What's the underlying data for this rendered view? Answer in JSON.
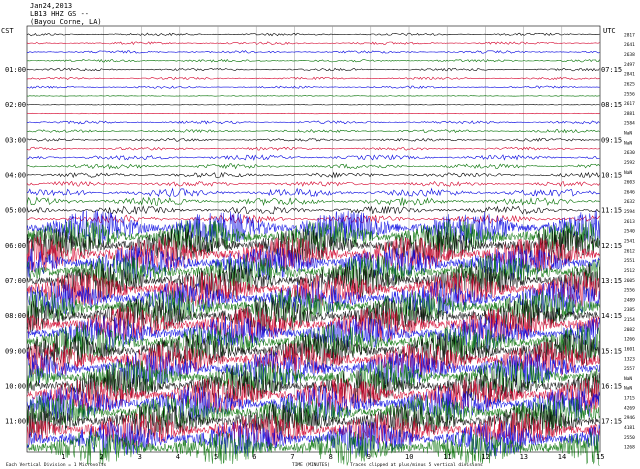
{
  "chart_data": {
    "type": "line",
    "title": "Jan24,2013",
    "subtitle": "LB13 HHZ GS --",
    "location": "(Bayou Corne, LA)",
    "left_timezone": "CST",
    "right_timezone": "UTC",
    "left_hour_labels": [
      "01:00",
      "02:00",
      "03:00",
      "04:00",
      "05:00",
      "06:00",
      "07:00",
      "08:00",
      "09:00",
      "10:00",
      "11:00"
    ],
    "right_hour_labels": [
      "07:15",
      "08:15",
      "09:15",
      "10:15",
      "11:15",
      "12:15",
      "13:15",
      "14:15",
      "15:15",
      "16:15",
      "17:15"
    ],
    "minute_ticks": [
      1,
      2,
      3,
      4,
      5,
      6,
      7,
      8,
      9,
      10,
      11,
      12,
      13,
      14,
      15
    ],
    "trace_colors": [
      "#000000",
      "#d4002a",
      "#0000e0",
      "#007000"
    ],
    "trace_count": 48,
    "right_counts": [
      "2817",
      "2641",
      "2638",
      "2497",
      "2841",
      "2625",
      "2556",
      "2617",
      "2881",
      "2584",
      "NaN",
      "NaN",
      "2630",
      "2592",
      "NaN",
      "2603",
      "2646",
      "2632",
      "2594",
      "2613",
      "2540",
      "2541",
      "2612",
      "2551",
      "2512",
      "2605",
      "2556",
      "2489",
      "2385",
      "2154",
      "2082",
      "1266",
      "1601",
      "1323",
      "2557",
      "NaN",
      "NaN",
      "1715",
      "4269",
      "2946",
      "4181",
      "2550",
      "1268"
    ],
    "footer_left": "Each Vertical Division = 1  Microvolts",
    "footer_center": "TIME (MINUTES)",
    "footer_right": "Traces clipped at plus/minus 5 vertical divisions"
  }
}
